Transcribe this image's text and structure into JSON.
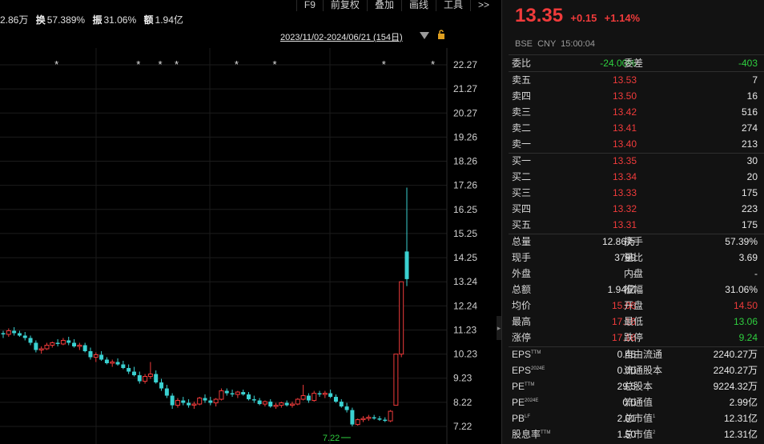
{
  "toolbar": {
    "f9": "F9",
    "restore": "前复权",
    "overlay": "叠加",
    "draw": "画线",
    "tools": "工具",
    "more": ">>"
  },
  "summary": {
    "vol": "2.86万",
    "turnover_label": "换",
    "turnover": "57.389%",
    "amp_label": "振",
    "amp": "31.06%",
    "amount_label": "额",
    "amount": "1.94亿"
  },
  "range": "2023/11/02-2024/06/21 (154日)",
  "y_axis": [
    "22.27",
    "21.27",
    "20.27",
    "19.26",
    "18.26",
    "17.26",
    "16.25",
    "15.25",
    "14.25",
    "13.24",
    "12.24",
    "11.23",
    "10.23",
    "9.23",
    "8.22",
    "7.22"
  ],
  "low_marker": "7.22",
  "header": {
    "price": "13.35",
    "change": "+0.15",
    "change_pct": "+1.14%",
    "meta": "BSE  CNY  15:00:04"
  },
  "ratio": {
    "label1": "委比",
    "value1": "-24.00%",
    "label2": "委差",
    "value2": "-403"
  },
  "asks": [
    {
      "label": "卖五",
      "price": "13.53",
      "vol": "7"
    },
    {
      "label": "卖四",
      "price": "13.50",
      "vol": "16"
    },
    {
      "label": "卖三",
      "price": "13.42",
      "vol": "516"
    },
    {
      "label": "卖二",
      "price": "13.41",
      "vol": "274"
    },
    {
      "label": "卖一",
      "price": "13.40",
      "vol": "213"
    }
  ],
  "bids": [
    {
      "label": "买一",
      "price": "13.35",
      "vol": "30"
    },
    {
      "label": "买二",
      "price": "13.34",
      "vol": "20"
    },
    {
      "label": "买三",
      "price": "13.33",
      "vol": "175"
    },
    {
      "label": "买四",
      "price": "13.32",
      "vol": "223"
    },
    {
      "label": "买五",
      "price": "13.31",
      "vol": "175"
    }
  ],
  "stats": [
    {
      "l1": "总量",
      "v1": "12.86万",
      "c1": "white",
      "l2": "换手",
      "v2": "57.39%",
      "c2": "white"
    },
    {
      "l1": "现手",
      "v1": "3799",
      "c1": "white",
      "l2": "量比",
      "v2": "3.69",
      "c2": "white"
    },
    {
      "l1": "外盘",
      "v1": "-",
      "c1": "white",
      "l2": "内盘",
      "v2": "-",
      "c2": "white"
    },
    {
      "l1": "总额",
      "v1": "1.94亿",
      "c1": "white",
      "l2": "振幅",
      "v2": "31.06%",
      "c2": "white"
    },
    {
      "l1": "均价",
      "v1": "15.06",
      "c1": "red",
      "l2": "开盘",
      "v2": "14.50",
      "c2": "red"
    },
    {
      "l1": "最高",
      "v1": "17.16",
      "c1": "red",
      "l2": "最低",
      "v2": "13.06",
      "c2": "green"
    },
    {
      "l1": "涨停",
      "v1": "17.16",
      "c1": "red",
      "l2": "跌停",
      "v2": "9.24",
      "c2": "green"
    }
  ],
  "fund": [
    {
      "l1": "EPS",
      "s1": "TTM",
      "v1": "0.45",
      "l2": "自由流通",
      "s2": "",
      "v2": "2240.27万"
    },
    {
      "l1": "EPS",
      "s1": "2024E",
      "v1": "0.00",
      "l2": "流通股本",
      "s2": "",
      "v2": "2240.27万"
    },
    {
      "l1": "PE",
      "s1": "TTM",
      "v1": "29.5",
      "l2": "总股本",
      "s2": "",
      "v2": "9224.32万"
    },
    {
      "l1": "PE",
      "s1": "2024E",
      "v1": "0.0",
      "l2": "流通值",
      "s2": "",
      "v2": "2.99亿"
    },
    {
      "l1": "PB",
      "s1": "LF",
      "v1": "2.01",
      "l2": "总市值",
      "s2": "1",
      "v2": "12.31亿"
    },
    {
      "l1": "股息率",
      "s1": "TTM",
      "v1": "1.50",
      "l2": "总市值",
      "s2": "2",
      "v2": "12.31亿"
    }
  ],
  "colors": {
    "up": "#f03b3b",
    "down": "#3ad1d1",
    "flat_green": "#2fcf3f"
  },
  "chart_data": {
    "type": "candlestick",
    "ylim": [
      7.22,
      22.27
    ],
    "candles": [
      [
        11.1,
        11.2,
        10.9,
        11.05
      ],
      [
        11.05,
        11.3,
        10.95,
        11.2
      ],
      [
        11.2,
        11.35,
        11.0,
        11.1
      ],
      [
        11.1,
        11.2,
        10.95,
        11.0
      ],
      [
        11.0,
        11.15,
        10.8,
        10.9
      ],
      [
        10.9,
        11.0,
        10.6,
        10.7
      ],
      [
        10.7,
        10.8,
        10.3,
        10.4
      ],
      [
        10.4,
        10.55,
        10.25,
        10.45
      ],
      [
        10.45,
        10.7,
        10.4,
        10.6
      ],
      [
        10.6,
        10.75,
        10.5,
        10.7
      ],
      [
        10.7,
        10.85,
        10.55,
        10.65
      ],
      [
        10.65,
        10.9,
        10.6,
        10.8
      ],
      [
        10.8,
        10.95,
        10.6,
        10.7
      ],
      [
        10.7,
        10.85,
        10.5,
        10.55
      ],
      [
        10.55,
        10.7,
        10.4,
        10.6
      ],
      [
        10.6,
        10.7,
        10.3,
        10.35
      ],
      [
        10.35,
        10.5,
        10.0,
        10.1
      ],
      [
        10.1,
        10.3,
        9.9,
        10.2
      ],
      [
        10.2,
        10.35,
        9.95,
        10.0
      ],
      [
        10.0,
        10.1,
        9.8,
        9.85
      ],
      [
        9.85,
        10.0,
        9.7,
        9.9
      ],
      [
        9.9,
        10.05,
        9.75,
        9.8
      ],
      [
        9.8,
        9.95,
        9.6,
        9.65
      ],
      [
        9.65,
        9.8,
        9.4,
        9.5
      ],
      [
        9.5,
        9.7,
        9.3,
        9.35
      ],
      [
        9.35,
        9.5,
        9.0,
        9.1
      ],
      [
        9.1,
        9.4,
        9.0,
        9.3
      ],
      [
        9.3,
        9.9,
        9.2,
        9.4
      ],
      [
        9.4,
        9.55,
        9.0,
        9.05
      ],
      [
        9.05,
        9.2,
        8.7,
        8.8
      ],
      [
        8.8,
        8.95,
        8.4,
        8.5
      ],
      [
        8.5,
        8.6,
        7.95,
        8.1
      ],
      [
        8.1,
        8.4,
        8.0,
        8.3
      ],
      [
        8.3,
        8.45,
        8.1,
        8.2
      ],
      [
        8.2,
        8.35,
        8.0,
        8.1
      ],
      [
        8.1,
        8.25,
        7.95,
        8.15
      ],
      [
        8.15,
        8.45,
        8.1,
        8.4
      ],
      [
        8.4,
        8.55,
        8.2,
        8.3
      ],
      [
        8.3,
        8.45,
        8.1,
        8.2
      ],
      [
        8.2,
        8.4,
        8.05,
        8.35
      ],
      [
        8.35,
        8.8,
        8.3,
        8.7
      ],
      [
        8.7,
        8.8,
        8.5,
        8.6
      ],
      [
        8.6,
        8.75,
        8.45,
        8.55
      ],
      [
        8.55,
        8.7,
        8.4,
        8.65
      ],
      [
        8.65,
        8.75,
        8.5,
        8.55
      ],
      [
        8.55,
        8.65,
        8.3,
        8.35
      ],
      [
        8.35,
        8.5,
        8.2,
        8.3
      ],
      [
        8.3,
        8.4,
        8.1,
        8.15
      ],
      [
        8.15,
        8.3,
        8.05,
        8.25
      ],
      [
        8.25,
        8.35,
        8.0,
        8.05
      ],
      [
        8.05,
        8.2,
        7.95,
        8.1
      ],
      [
        8.1,
        8.25,
        8.0,
        8.2
      ],
      [
        8.2,
        8.3,
        8.05,
        8.1
      ],
      [
        8.1,
        8.25,
        8.0,
        8.15
      ],
      [
        8.15,
        8.4,
        8.1,
        8.35
      ],
      [
        8.35,
        8.95,
        8.3,
        8.5
      ],
      [
        8.5,
        8.6,
        8.2,
        8.3
      ],
      [
        8.3,
        8.7,
        8.25,
        8.6
      ],
      [
        8.6,
        8.7,
        8.45,
        8.55
      ],
      [
        8.55,
        8.7,
        8.4,
        8.6
      ],
      [
        8.6,
        8.75,
        8.4,
        8.45
      ],
      [
        8.45,
        8.55,
        8.2,
        8.25
      ],
      [
        8.25,
        8.35,
        8.0,
        8.05
      ],
      [
        8.05,
        8.2,
        7.8,
        7.9
      ],
      [
        7.9,
        8.0,
        7.22,
        7.3
      ],
      [
        7.3,
        7.55,
        7.25,
        7.5
      ],
      [
        7.5,
        7.65,
        7.4,
        7.55
      ],
      [
        7.55,
        7.7,
        7.45,
        7.6
      ],
      [
        7.6,
        7.7,
        7.5,
        7.55
      ],
      [
        7.55,
        7.65,
        7.45,
        7.5
      ],
      [
        7.5,
        7.6,
        7.4,
        7.45
      ],
      [
        7.45,
        7.9,
        7.4,
        7.85
      ],
      [
        8.1,
        10.23,
        8.1,
        10.23
      ],
      [
        10.23,
        13.24,
        10.1,
        13.24
      ],
      [
        14.5,
        17.16,
        13.06,
        13.35
      ]
    ],
    "stars_index": [
      10,
      25,
      29,
      32,
      43,
      50,
      70,
      79
    ]
  }
}
